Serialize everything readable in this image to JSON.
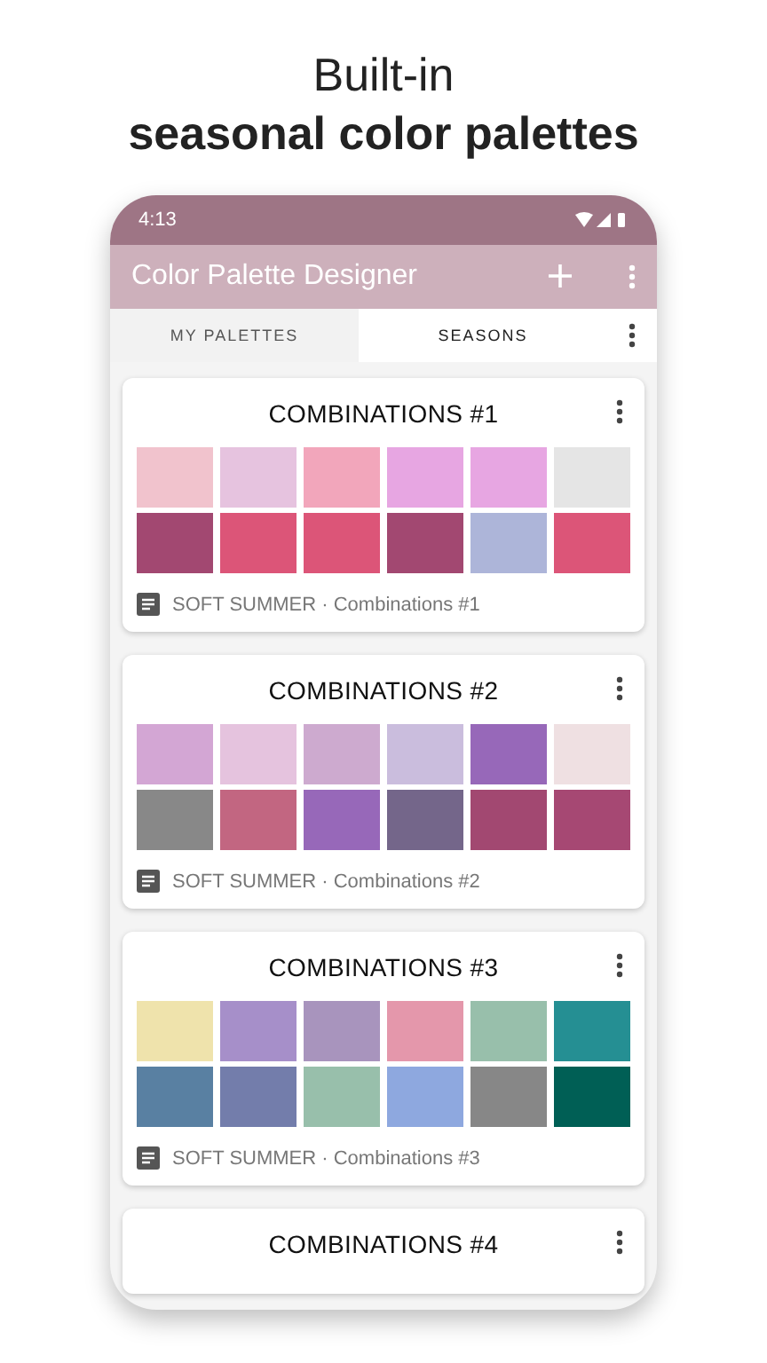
{
  "headline": {
    "line_1": "Built-in",
    "line_2": "seasonal color palettes"
  },
  "status_bar": {
    "time": "4:13"
  },
  "app_bar": {
    "title": "Color Palette Designer"
  },
  "tabs": [
    {
      "label": "MY PALETTES",
      "selected": false
    },
    {
      "label": "SEASONS",
      "selected": true
    }
  ],
  "cards": [
    {
      "title": "COMBINATIONS #1",
      "footer": "SOFT SUMMER · Combinations #1",
      "swatches": [
        {
          "color": "#f1c3cd"
        },
        {
          "color": "#e6c3df"
        },
        {
          "color": "#f2a6bb"
        },
        {
          "color": "#e7a6e2"
        },
        {
          "color": "#e7a6e2"
        },
        {
          "color": "#e5e5e5"
        },
        {
          "color": "#a24871"
        },
        {
          "color": "#dc5578"
        },
        {
          "color": "#dc5578"
        },
        {
          "color": "#a24871"
        },
        {
          "color": "#adb5d9"
        },
        {
          "color": "#dc5578"
        }
      ]
    },
    {
      "title": "COMBINATIONS #2",
      "footer": "SOFT SUMMER · Combinations #2",
      "swatches": [
        {
          "color": "#d3a6d4"
        },
        {
          "color": "#e5c3de"
        },
        {
          "color": "#cdaacf"
        },
        {
          "color": "#cabddd"
        },
        {
          "color": "#9768b9"
        },
        {
          "color": "#efe0e2"
        },
        {
          "color": "#888888"
        },
        {
          "color": "#c26681"
        },
        {
          "color": "#9768b9"
        },
        {
          "color": "#74668a"
        },
        {
          "color": "#a24871"
        },
        {
          "color": "#a64873"
        }
      ]
    },
    {
      "title": "COMBINATIONS #3",
      "footer": "SOFT SUMMER · Combinations #3",
      "swatches": [
        {
          "color": "#efe3ac"
        },
        {
          "color": "#a68fc9"
        },
        {
          "color": "#a894bd"
        },
        {
          "color": "#e497ab"
        },
        {
          "color": "#98bfab"
        },
        {
          "color": "#258f93"
        },
        {
          "color": "#5980a2"
        },
        {
          "color": "#737dab"
        },
        {
          "color": "#98bfab"
        },
        {
          "color": "#8ea8df"
        },
        {
          "color": "#878787"
        },
        {
          "color": "#005f55"
        }
      ]
    },
    {
      "title": "COMBINATIONS #4"
    }
  ]
}
